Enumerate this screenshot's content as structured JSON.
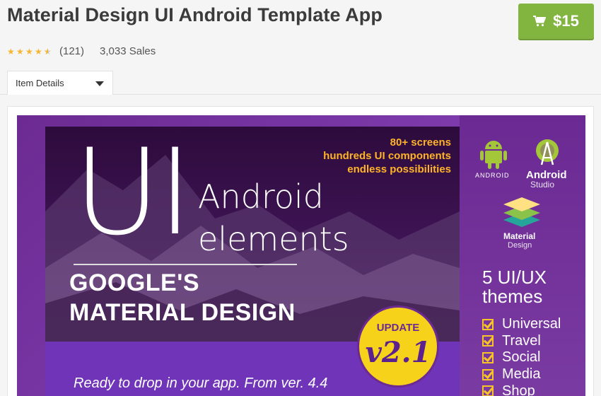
{
  "product": {
    "title": "Material Design UI Android Template App",
    "price": "$15",
    "rating_count": "(121)",
    "sales": "3,033 Sales",
    "rating": 4.5
  },
  "tabs": {
    "item_details": "Item Details"
  },
  "banner": {
    "highlights": [
      "80+ screens",
      "hundreds UI components",
      "endless possibilities"
    ],
    "ui": "UI",
    "android": "Android",
    "elements": "elements",
    "googles": "GOOGLE'S",
    "material_design": "MATERIAL DESIGN",
    "tagline": "Ready to drop in your app. From ver. 4.4",
    "update_label": "UPDATE",
    "version": "v2.1",
    "logo_android": "ANDROID",
    "logo_studio_line1": "Android",
    "logo_studio_line2": "Studio",
    "logo_material_line1": "Material",
    "logo_material_line2": "Design",
    "themes_line1": "5 UI/UX",
    "themes_line2": "themes",
    "themes": [
      "Universal",
      "Travel",
      "Social",
      "Media",
      "Shop"
    ]
  },
  "colors": {
    "buy": "#82b440",
    "star": "#f5b52e",
    "banner_purple": "#6c2a92",
    "accent_yellow": "#f7d21a"
  }
}
